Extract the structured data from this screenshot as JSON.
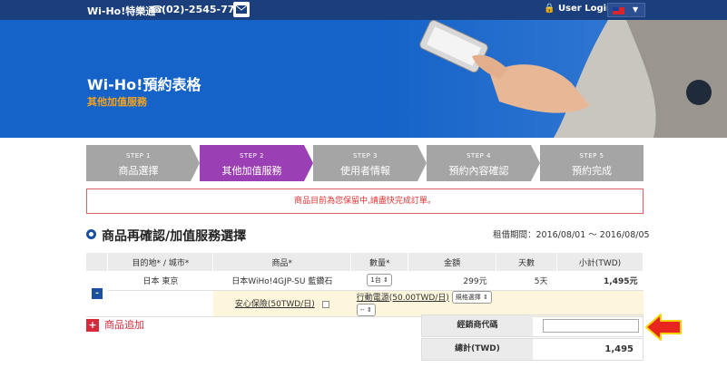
{
  "topbar": {
    "brand": "Wi-Ho!特樂通",
    "phone": "(02)-2545-7777",
    "login": "User Login"
  },
  "banner": {
    "title": "Wi-Ho!預約表格",
    "subtitle": "其他加值服務"
  },
  "steps": [
    {
      "label": "STEP 1",
      "name": "商品選擇",
      "active": false
    },
    {
      "label": "STEP 2",
      "name": "其他加值服務",
      "active": true
    },
    {
      "label": "STEP 3",
      "name": "使用者情報",
      "active": false
    },
    {
      "label": "STEP 4",
      "name": "預約內容確認",
      "active": false
    },
    {
      "label": "STEP 5",
      "name": "預約完成",
      "active": false
    }
  ],
  "warning": "商品目前為您保留中,請盡快完成訂單。",
  "section": {
    "title": "商品再確認/加值服務選擇",
    "rental_period": "租借期間：2016/08/01 ～ 2016/08/05"
  },
  "table": {
    "headers": [
      "目的地* / 城市*",
      "商品*",
      "數量*",
      "金額",
      "天數",
      "小計(TWD)"
    ],
    "row": {
      "remove": "-",
      "destination": "日本 東京",
      "product": "日本WiHo!4GJP-SU 藍鑽石",
      "qty": "1台",
      "price": "299元",
      "days": "5天",
      "subtotal": "1,495元"
    },
    "options": {
      "insurance": "安心保險(50TWD/日)",
      "power": "行動電源(50.00TWD/日)",
      "spec_select": "規格選擇",
      "qty_select": "--"
    }
  },
  "add_product": "商品追加",
  "dealer": {
    "label": "經銷商代碼",
    "value": ""
  },
  "total": {
    "label": "總計(TWD)",
    "value": "1,495"
  },
  "colors": {
    "topbar": "#1b3f7d",
    "banner": "#1563c8",
    "step_active": "#9b3fb4",
    "step_inactive": "#a5a5a5",
    "accent_orange": "#f7a21b",
    "callout_arrow": "#e8261f"
  }
}
